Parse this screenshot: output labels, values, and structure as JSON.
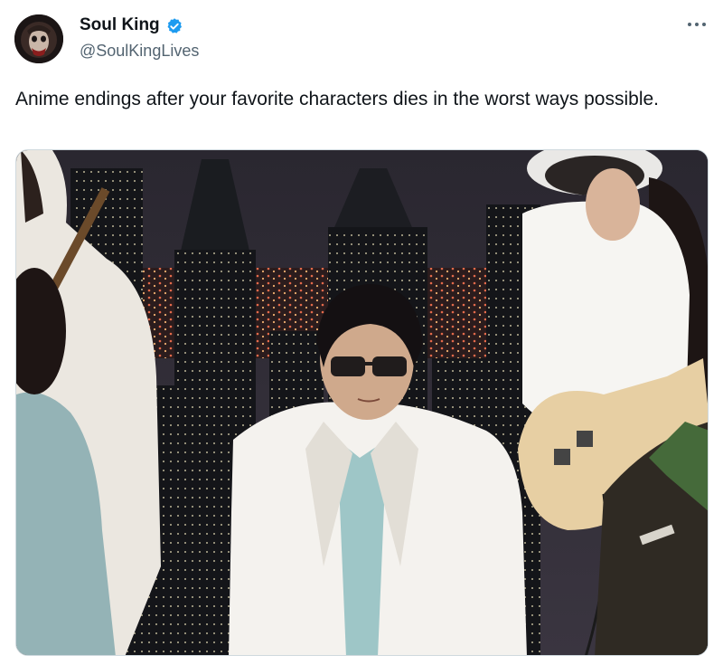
{
  "author": {
    "display_name": "Soul King",
    "handle": "@SoulKingLives",
    "verified": true
  },
  "tweet": {
    "text": "Anime endings after your favorite characters dies in the worst ways possible."
  },
  "icons": {
    "verified": "verified-badge-icon",
    "more": "more-options-icon"
  },
  "colors": {
    "verified_blue": "#1d9bf0",
    "text": "#0f1419",
    "secondary": "#536471"
  }
}
